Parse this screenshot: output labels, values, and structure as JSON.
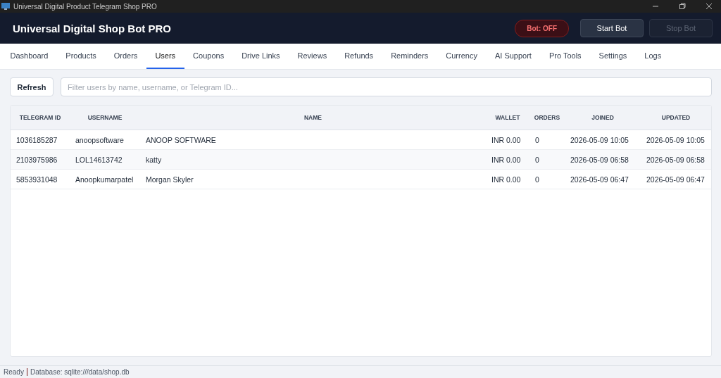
{
  "window": {
    "title": "Universal Digital Product Telegram Shop PRO"
  },
  "header": {
    "title": "Universal Digital Shop Bot PRO",
    "status": "Bot: OFF",
    "bot_on": false,
    "buttons": [
      {
        "label": "Start Bot",
        "disabled": false
      },
      {
        "label": "Stop Bot",
        "disabled": true
      }
    ]
  },
  "tabs": [
    {
      "label": "Dashboard",
      "selected": false
    },
    {
      "label": "Products",
      "selected": false
    },
    {
      "label": "Orders",
      "selected": false
    },
    {
      "label": "Users",
      "selected": true
    },
    {
      "label": "Coupons",
      "selected": false
    },
    {
      "label": "Drive Links",
      "selected": false
    },
    {
      "label": "Reviews",
      "selected": false
    },
    {
      "label": "Refunds",
      "selected": false
    },
    {
      "label": "Reminders",
      "selected": false
    },
    {
      "label": "Currency",
      "selected": false
    },
    {
      "label": "AI Support",
      "selected": false
    },
    {
      "label": "Pro Tools",
      "selected": false
    },
    {
      "label": "Settings",
      "selected": false
    },
    {
      "label": "Logs",
      "selected": false
    }
  ],
  "toolbar": {
    "refresh": "Refresh",
    "search": {
      "placeholder": "Filter users by name, username, or Telegram ID..."
    }
  },
  "table": {
    "columns": [
      "TELEGRAM ID",
      "USERNAME",
      "NAME",
      "WALLET",
      "ORDERS",
      "JOINED",
      "UPDATED"
    ],
    "rows": [
      [
        "1036185287",
        "anoopsoftware",
        "ANOOP SOFTWARE",
        "INR 0.00",
        "0",
        "2026-05-09 10:05",
        "2026-05-09 10:05"
      ],
      [
        "2103975986",
        "LOL14613742",
        "katty",
        "INR 0.00",
        "0",
        "2026-05-09 06:58",
        "2026-05-09 06:58"
      ],
      [
        "5853931048",
        "Anoopkumarpatel",
        "Morgan Skyler",
        "INR 0.00",
        "0",
        "2026-05-09 06:47",
        "2026-05-09 06:47"
      ]
    ]
  },
  "status_bar": {
    "ready": "Ready",
    "database": "Database: sqlite:///data/shop.db"
  }
}
